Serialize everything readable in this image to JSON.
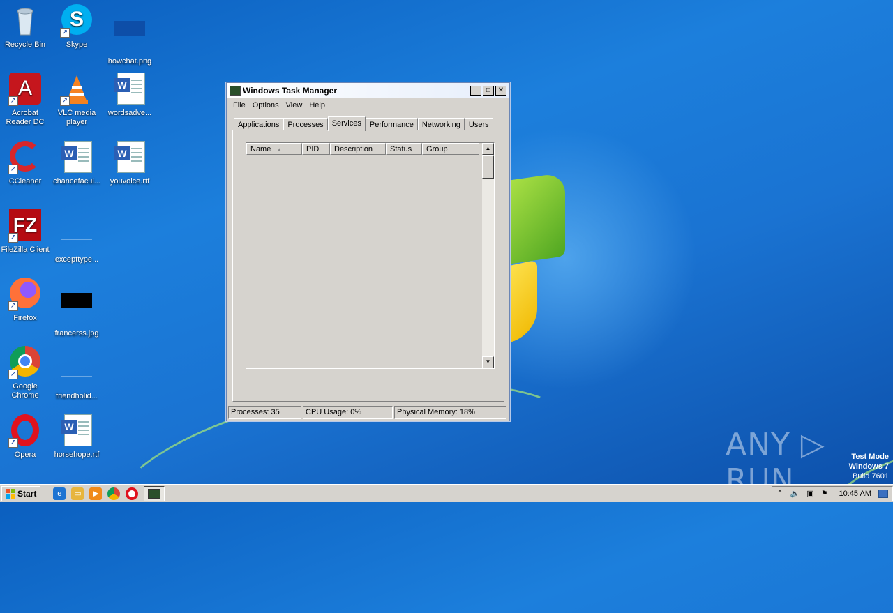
{
  "desktop": {
    "icons": [
      {
        "label": "Recycle Bin",
        "icon": "recycle-bin-icon"
      },
      {
        "label": "Skype",
        "icon": "skype-icon"
      },
      {
        "label": "howchat.png",
        "icon": "image-file-icon"
      },
      {
        "label": "Acrobat Reader DC",
        "icon": "acrobat-icon"
      },
      {
        "label": "VLC media player",
        "icon": "vlc-icon"
      },
      {
        "label": "wordsadve...",
        "icon": "word-doc-icon"
      },
      {
        "label": "CCleaner",
        "icon": "ccleaner-icon"
      },
      {
        "label": "chancefacul...",
        "icon": "word-doc-icon"
      },
      {
        "label": "youvoice.rtf",
        "icon": "word-doc-icon"
      },
      {
        "label": "FileZilla Client",
        "icon": "filezilla-icon"
      },
      {
        "label": "excepttype...",
        "icon": "image-file-icon"
      },
      {
        "label": "Firefox",
        "icon": "firefox-icon"
      },
      {
        "label": "francerss.jpg",
        "icon": "image-file-icon"
      },
      {
        "label": "Google Chrome",
        "icon": "chrome-icon"
      },
      {
        "label": "friendholid...",
        "icon": "image-file-icon"
      },
      {
        "label": "Opera",
        "icon": "opera-icon"
      },
      {
        "label": "horsehope.rtf",
        "icon": "word-doc-icon"
      }
    ]
  },
  "window": {
    "title": "Windows Task Manager",
    "menu": [
      "File",
      "Options",
      "View",
      "Help"
    ],
    "tabs": [
      "Applications",
      "Processes",
      "Services",
      "Performance",
      "Networking",
      "Users"
    ],
    "active_tab": "Services",
    "columns": [
      "Name",
      "PID",
      "Description",
      "Status",
      "Group"
    ],
    "status": {
      "processes": "Processes: 35",
      "cpu": "CPU Usage: 0%",
      "memory": "Physical Memory: 18%"
    }
  },
  "taskbar": {
    "start_label": "Start",
    "clock": "10:45 AM",
    "quick_launch": [
      "ie-icon",
      "explorer-icon",
      "media-player-icon",
      "chrome-icon",
      "opera-icon"
    ]
  },
  "watermark": {
    "line1": "Test Mode",
    "line2": "Windows 7",
    "line3": "Build 7601",
    "brand": "ANY RUN"
  },
  "colors": {
    "desktop": "#1a73d2",
    "window_face": "#d6d3ce",
    "titlebar": "#e6eefb"
  }
}
